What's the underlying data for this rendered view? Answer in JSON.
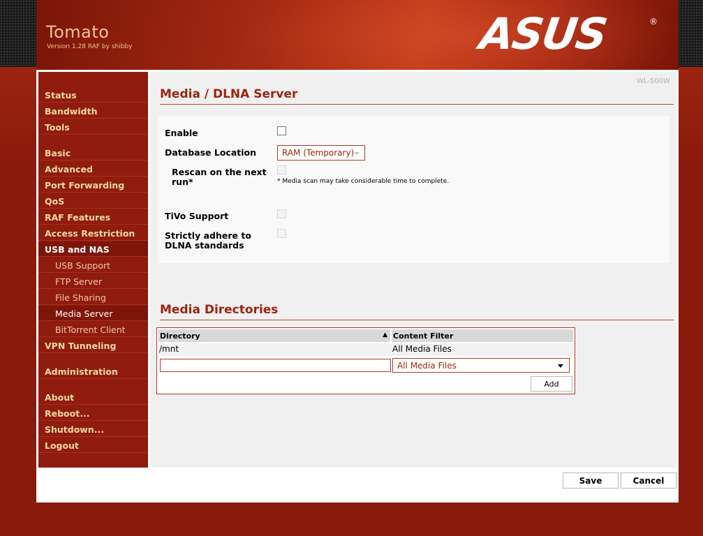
{
  "header": {
    "title": "Tomato",
    "subtitle": "Version 1.28 RAF by shibby",
    "logo_text": "ASUS",
    "logo_reg": "®"
  },
  "model": "WL-500W",
  "nav": {
    "status": "Status",
    "bandwidth": "Bandwidth",
    "tools": "Tools",
    "basic": "Basic",
    "advanced": "Advanced",
    "port_forwarding": "Port Forwarding",
    "qos": "QoS",
    "raf_features": "RAF Features",
    "access_restriction": "Access Restriction",
    "usb_and_nas": "USB and NAS",
    "usb_support": "USB Support",
    "ftp_server": "FTP Server",
    "file_sharing": "File Sharing",
    "media_server": "Media Server",
    "bittorrent_client": "BitTorrent Client",
    "vpn_tunneling": "VPN Tunneling",
    "administration": "Administration",
    "about": "About",
    "reboot": "Reboot...",
    "shutdown": "Shutdown...",
    "logout": "Logout"
  },
  "server": {
    "title": "Media / DLNA Server",
    "enable_label": "Enable",
    "enable_checked": false,
    "db_location_label": "Database Location",
    "db_location_value": "RAM (Temporary)",
    "rescan_label_line1": "Rescan on the next",
    "rescan_label_line2": "run*",
    "rescan_note": "* Media scan may take considerable time to complete.",
    "tivo_label": "TiVo Support",
    "strict_label_line1": "Strictly adhere to",
    "strict_label_line2": "DLNA standards"
  },
  "directories": {
    "title": "Media Directories",
    "col_directory": "Directory",
    "col_filter": "Content Filter",
    "sort_indicator": "▲",
    "rows": [
      {
        "directory": "/mnt",
        "filter": "All Media Files"
      }
    ],
    "new_directory_value": "",
    "new_filter_value": "All Media Files",
    "add_label": "Add"
  },
  "footer": {
    "save_label": "Save",
    "cancel_label": "Cancel"
  },
  "colors": {
    "brand_red": "#8f1c0e",
    "accent_text": "#9c2410",
    "nav_text": "#f5d9a0"
  }
}
